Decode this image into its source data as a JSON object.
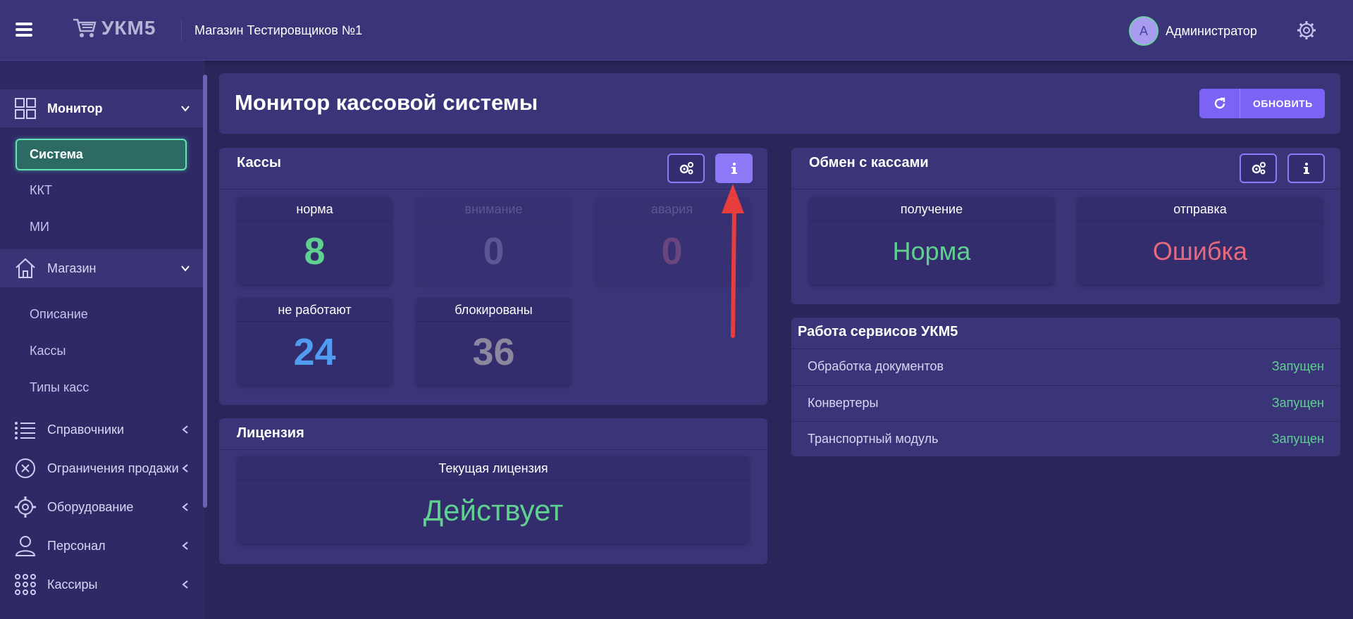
{
  "header": {
    "app_name": "УКМ5",
    "store_name": "Магазин Тестировщиков №1",
    "user_initial": "A",
    "user_name": "Администратор"
  },
  "sidebar": {
    "monitor_label": "Монитор",
    "monitor_items": [
      "Система",
      "ККТ",
      "МИ"
    ],
    "store_label": "Магазин",
    "store_items": [
      "Описание",
      "Кассы",
      "Типы касс"
    ],
    "groups": [
      "Справочники",
      "Ограничения продажи",
      "Оборудование",
      "Персонал",
      "Кассиры"
    ]
  },
  "page": {
    "title": "Монитор кассовой системы",
    "refresh_label": "ОБНОВИТЬ"
  },
  "kassy": {
    "title": "Кассы",
    "stats": [
      {
        "label": "норма",
        "value": "8",
        "color": "#5fd08f"
      },
      {
        "label": "внимание",
        "value": "0",
        "color": "#9a95c8"
      },
      {
        "label": "авария",
        "value": "0",
        "color": "#c46a8a"
      },
      {
        "label": "не работают",
        "value": "24",
        "color": "#4f9cf0"
      },
      {
        "label": "блокированы",
        "value": "36",
        "color": "#8a879e"
      }
    ]
  },
  "license": {
    "title": "Лицензия",
    "current_label": "Текущая лицензия",
    "status": "Действует",
    "status_color": "#5fd08f"
  },
  "exchange": {
    "title": "Обмен с кассами",
    "receive_label": "получение",
    "receive_value": "Норма",
    "receive_color": "#5fd08f",
    "send_label": "отправка",
    "send_value": "Ошибка",
    "send_color": "#e56a7c"
  },
  "services": {
    "title": "Работа сервисов УКМ5",
    "rows": [
      {
        "name": "Обработка документов",
        "status": "Запущен"
      },
      {
        "name": "Конвертеры",
        "status": "Запущен"
      },
      {
        "name": "Транспортный модуль",
        "status": "Запущен"
      }
    ]
  },
  "icons": [
    "menu-icon",
    "cart-icon",
    "gear-icon",
    "refresh-icon",
    "settings-gears-icon",
    "info-icon",
    "chevron-down-icon",
    "chevron-left-icon"
  ],
  "colors": {
    "accent": "#7b63f5",
    "success": "#5fd08f",
    "error": "#e56a7c",
    "active_border": "#62e3b1"
  }
}
